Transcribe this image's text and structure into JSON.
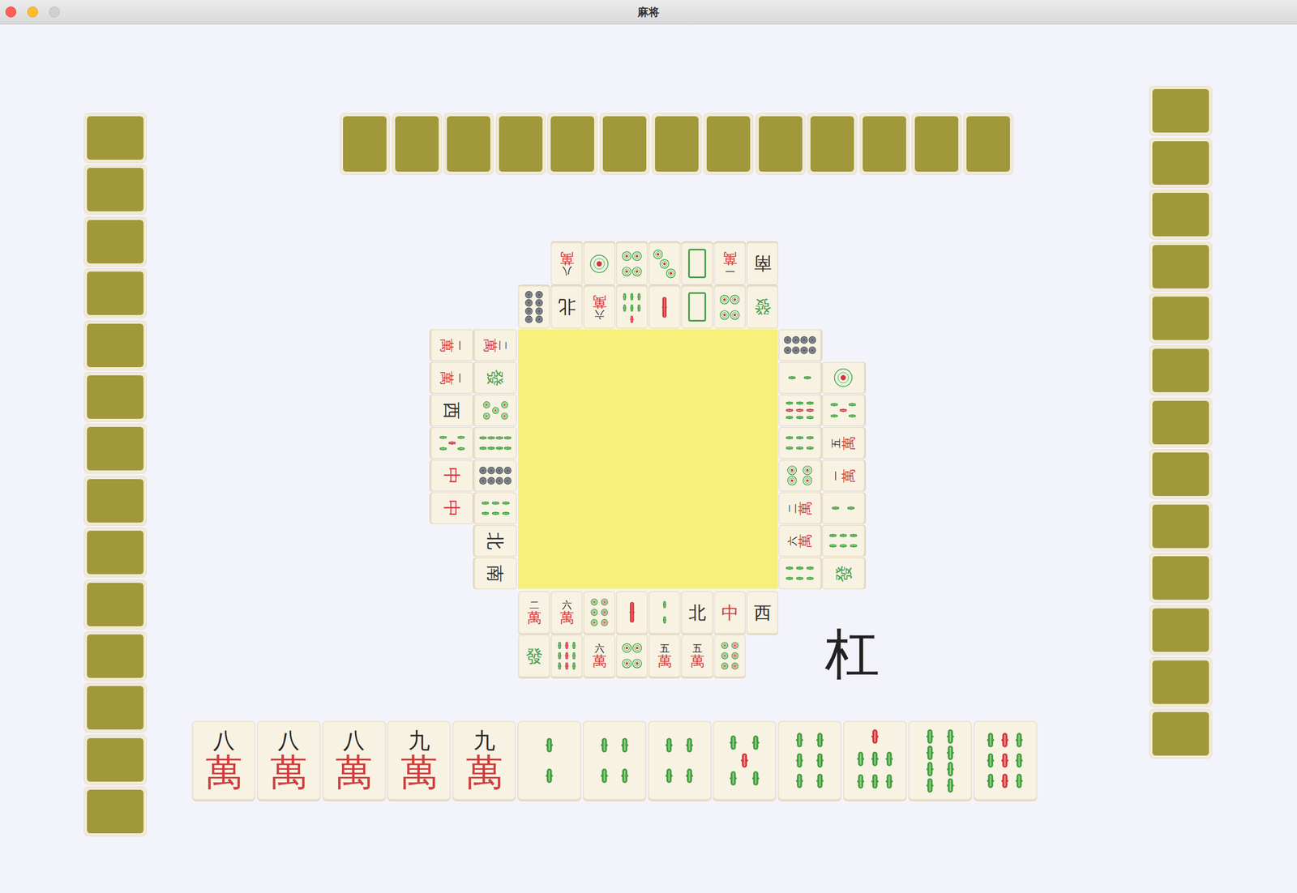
{
  "window": {
    "title": "麻将"
  },
  "opponents": {
    "left": {
      "hidden": 14
    },
    "top": {
      "hidden": 13
    },
    "right": {
      "hidden": 13
    }
  },
  "discards": {
    "top": [
      [
        {
          "kind": "wan",
          "rank": "八",
          "suit": "萬"
        },
        {
          "kind": "circle",
          "value": 1
        },
        {
          "kind": "circle",
          "value": 4
        },
        {
          "kind": "circle",
          "value": 3
        },
        {
          "kind": "white"
        },
        {
          "kind": "wan",
          "rank": "一",
          "suit": "萬"
        },
        {
          "kind": "honor",
          "text": "南",
          "color": "#2a2a2a"
        }
      ],
      [
        {
          "kind": "circle",
          "value": 8
        },
        {
          "kind": "honor",
          "text": "北",
          "color": "#2a2a2a"
        },
        {
          "kind": "wan",
          "rank": "六",
          "suit": "萬"
        },
        {
          "kind": "bamboo",
          "value": 7
        },
        {
          "kind": "bamboo",
          "value": 1
        },
        {
          "kind": "white"
        },
        {
          "kind": "circle",
          "value": 4
        },
        {
          "kind": "honor",
          "text": "發",
          "color": "#4aa04a"
        }
      ]
    ],
    "left": [
      [
        {
          "kind": "wan",
          "rank": "一",
          "suit": "萬"
        },
        {
          "kind": "wan",
          "rank": "一",
          "suit": "萬"
        },
        {
          "kind": "honor",
          "text": "西",
          "color": "#2a2a2a"
        },
        {
          "kind": "bamboo",
          "value": 5
        },
        {
          "kind": "honor",
          "text": "中",
          "color": "#d03a3a"
        },
        {
          "kind": "honor",
          "text": "中",
          "color": "#d03a3a"
        }
      ],
      [
        {
          "kind": "wan",
          "rank": "二",
          "suit": "萬"
        },
        {
          "kind": "honor",
          "text": "發",
          "color": "#4aa04a"
        },
        {
          "kind": "circle",
          "value": 5
        },
        {
          "kind": "bamboo",
          "value": 8
        },
        {
          "kind": "circle",
          "value": 8
        },
        {
          "kind": "bamboo",
          "value": 6
        },
        {
          "kind": "honor",
          "text": "北",
          "color": "#2a2a2a"
        },
        {
          "kind": "honor",
          "text": "南",
          "color": "#2a2a2a"
        }
      ]
    ],
    "right": [
      [
        {
          "kind": "circle",
          "value": 8
        },
        {
          "kind": "bamboo",
          "value": 2
        },
        {
          "kind": "bamboo",
          "value": 9
        },
        {
          "kind": "bamboo",
          "value": 6
        },
        {
          "kind": "circle",
          "value": 4
        },
        {
          "kind": "wan",
          "rank": "二",
          "suit": "萬"
        },
        {
          "kind": "wan",
          "rank": "六",
          "suit": "萬"
        },
        {
          "kind": "bamboo",
          "value": 6
        }
      ],
      [
        {
          "kind": "circle",
          "value": 1
        },
        {
          "kind": "bamboo",
          "value": 5
        },
        {
          "kind": "wan",
          "rank": "五",
          "suit": "萬"
        },
        {
          "kind": "wan",
          "rank": "一",
          "suit": "萬"
        },
        {
          "kind": "bamboo",
          "value": 2
        },
        {
          "kind": "bamboo",
          "value": 6
        },
        {
          "kind": "honor",
          "text": "發",
          "color": "#4aa04a"
        }
      ]
    ],
    "bottom": [
      [
        {
          "kind": "wan",
          "rank": "二",
          "suit": "萬"
        },
        {
          "kind": "wan",
          "rank": "六",
          "suit": "萬"
        },
        {
          "kind": "circle",
          "value": 6
        },
        {
          "kind": "bamboo",
          "value": 1
        },
        {
          "kind": "bamboo",
          "value": 2
        },
        {
          "kind": "honor",
          "text": "北",
          "color": "#2a2a2a"
        },
        {
          "kind": "honor",
          "text": "中",
          "color": "#d03a3a"
        },
        {
          "kind": "honor",
          "text": "西",
          "color": "#2a2a2a"
        }
      ],
      [
        {
          "kind": "honor",
          "text": "發",
          "color": "#4aa04a"
        },
        {
          "kind": "bamboo",
          "value": 9
        },
        {
          "kind": "wan",
          "rank": "六",
          "suit": "萬"
        },
        {
          "kind": "circle",
          "value": 4
        },
        {
          "kind": "wan",
          "rank": "五",
          "suit": "萬"
        },
        {
          "kind": "wan",
          "rank": "五",
          "suit": "萬"
        },
        {
          "kind": "circle",
          "value": 6
        }
      ]
    ]
  },
  "hand": [
    {
      "kind": "wan",
      "rank": "八",
      "suit": "萬"
    },
    {
      "kind": "wan",
      "rank": "八",
      "suit": "萬"
    },
    {
      "kind": "wan",
      "rank": "八",
      "suit": "萬"
    },
    {
      "kind": "wan",
      "rank": "九",
      "suit": "萬"
    },
    {
      "kind": "wan",
      "rank": "九",
      "suit": "萬"
    },
    {
      "kind": "bamboo",
      "value": 2
    },
    {
      "kind": "bamboo",
      "value": 4
    },
    {
      "kind": "bamboo",
      "value": 4
    },
    {
      "kind": "bamboo",
      "value": 5
    },
    {
      "kind": "bamboo",
      "value": 6
    },
    {
      "kind": "bamboo",
      "value": 7
    },
    {
      "kind": "bamboo",
      "value": 8
    },
    {
      "kind": "bamboo",
      "value": 9
    }
  ],
  "action": {
    "label": "杠"
  }
}
